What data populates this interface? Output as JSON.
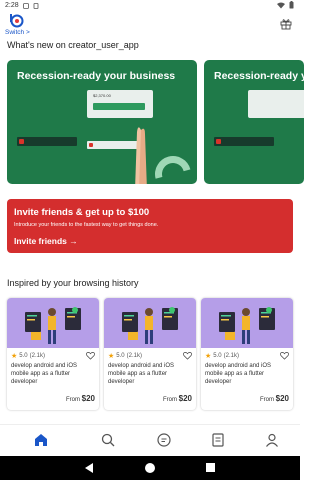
{
  "status_bar": {
    "time": "2:28",
    "icons_left": [
      "notification-icon",
      "b-icon"
    ],
    "icons_right": [
      "wifi-icon",
      "battery-icon"
    ]
  },
  "header": {
    "switch_label": "Switch >"
  },
  "whats_new": {
    "title": "What's new on creator_user_app"
  },
  "banners": [
    {
      "title": "Recession-ready your business",
      "amount": "$2,370.00"
    },
    {
      "title": "Recession-ready your business"
    }
  ],
  "invite": {
    "title": "Invite friends & get up to $100",
    "subtitle": "Introduce your friends to the fastest way to get things done.",
    "cta": "Invite friends →"
  },
  "history": {
    "title": "Inspired by your browsing history",
    "gigs": [
      {
        "rating": "5.0",
        "reviews": "(2.1k)",
        "title": "develop android and iOS mobile app as a flutter developer",
        "from_label": "From",
        "price": "$20"
      },
      {
        "rating": "5.0",
        "reviews": "(2.1k)",
        "title": "develop android and iOS mobile app as a flutter developer",
        "from_label": "From",
        "price": "$20"
      },
      {
        "rating": "5.0",
        "reviews": "(2.1k)",
        "title": "develop android and iOS mobile app as a flutter developer",
        "from_label": "From",
        "price": "$20"
      }
    ]
  },
  "bottom_nav": [
    "home-icon",
    "search-icon",
    "messages-icon",
    "orders-icon",
    "profile-icon"
  ],
  "colors": {
    "accent": "#1a56c8",
    "invite_bg": "#d42e2e",
    "banner_bg": "#1f7a49",
    "gig_img_bg": "#b59ee8"
  }
}
